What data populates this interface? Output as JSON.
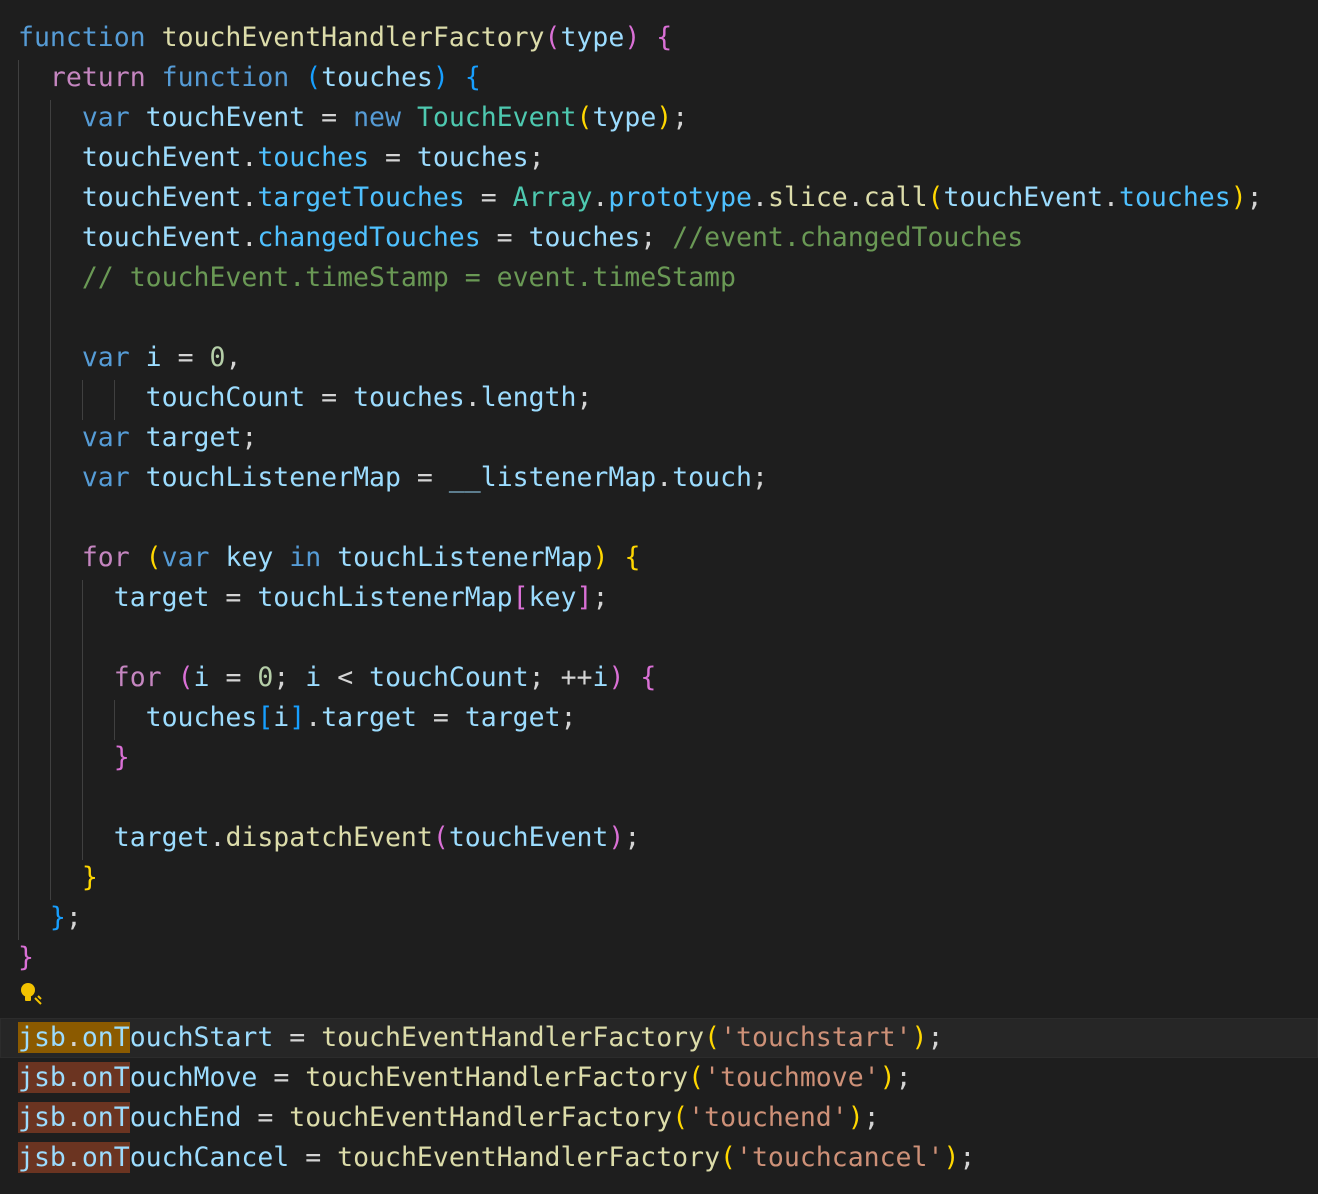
{
  "editor": {
    "language": "javascript",
    "theme_colors": {
      "background": "#1e1e1e",
      "keyword": "#569cd6",
      "control": "#c586c0",
      "function": "#dcdcaa",
      "variable": "#9cdcfe",
      "class": "#4ec9b0",
      "number": "#b5cea8",
      "string": "#ce9178",
      "comment": "#6a9955",
      "bracket_1": "#ffd700",
      "bracket_2": "#da70d6",
      "bracket_3": "#179fff",
      "selection_highlight": "#6b3421"
    },
    "lightbulb_icon": "lightbulb-icon",
    "lines": [
      [
        [
          "kw",
          "function"
        ],
        [
          "op",
          " "
        ],
        [
          "fn",
          "touchEventHandlerFactory"
        ],
        [
          "b2",
          "("
        ],
        [
          "var",
          "type"
        ],
        [
          "b2",
          ")"
        ],
        [
          "op",
          " "
        ],
        [
          "b2",
          "{"
        ]
      ],
      [
        [
          "op",
          "  "
        ],
        [
          "ctl",
          "return"
        ],
        [
          "op",
          " "
        ],
        [
          "kw",
          "function"
        ],
        [
          "op",
          " "
        ],
        [
          "b3",
          "("
        ],
        [
          "var",
          "touches"
        ],
        [
          "b3",
          ")"
        ],
        [
          "op",
          " "
        ],
        [
          "b3",
          "{"
        ]
      ],
      [
        [
          "op",
          "    "
        ],
        [
          "kw",
          "var"
        ],
        [
          "op",
          " "
        ],
        [
          "var",
          "touchEvent"
        ],
        [
          "op",
          " = "
        ],
        [
          "kw",
          "new"
        ],
        [
          "op",
          " "
        ],
        [
          "cls",
          "TouchEvent"
        ],
        [
          "b1",
          "("
        ],
        [
          "var",
          "type"
        ],
        [
          "b1",
          ")"
        ],
        [
          "op",
          ";"
        ]
      ],
      [
        [
          "op",
          "    "
        ],
        [
          "var",
          "touchEvent"
        ],
        [
          "op",
          "."
        ],
        [
          "prop",
          "touches"
        ],
        [
          "op",
          " = "
        ],
        [
          "var",
          "touches"
        ],
        [
          "op",
          ";"
        ]
      ],
      [
        [
          "op",
          "    "
        ],
        [
          "var",
          "touchEvent"
        ],
        [
          "op",
          "."
        ],
        [
          "prop",
          "targetTouches"
        ],
        [
          "op",
          " = "
        ],
        [
          "cls",
          "Array"
        ],
        [
          "op",
          "."
        ],
        [
          "prop",
          "prototype"
        ],
        [
          "op",
          "."
        ],
        [
          "fn",
          "slice"
        ],
        [
          "op",
          "."
        ],
        [
          "fn",
          "call"
        ],
        [
          "b1",
          "("
        ],
        [
          "var",
          "touchEvent"
        ],
        [
          "op",
          "."
        ],
        [
          "prop",
          "touches"
        ],
        [
          "b1",
          ")"
        ],
        [
          "op",
          ";"
        ]
      ],
      [
        [
          "op",
          "    "
        ],
        [
          "var",
          "touchEvent"
        ],
        [
          "op",
          "."
        ],
        [
          "prop",
          "changedTouches"
        ],
        [
          "op",
          " = "
        ],
        [
          "var",
          "touches"
        ],
        [
          "op",
          "; "
        ],
        [
          "cmt",
          "//event.changedTouches"
        ]
      ],
      [
        [
          "op",
          "    "
        ],
        [
          "cmt",
          "// touchEvent.timeStamp = event.timeStamp"
        ]
      ],
      [],
      [
        [
          "op",
          "    "
        ],
        [
          "kw",
          "var"
        ],
        [
          "op",
          " "
        ],
        [
          "var",
          "i"
        ],
        [
          "op",
          " = "
        ],
        [
          "num",
          "0"
        ],
        [
          "op",
          ","
        ]
      ],
      [
        [
          "op",
          "        "
        ],
        [
          "var",
          "touchCount"
        ],
        [
          "op",
          " = "
        ],
        [
          "var",
          "touches"
        ],
        [
          "op",
          "."
        ],
        [
          "var",
          "length"
        ],
        [
          "op",
          ";"
        ]
      ],
      [
        [
          "op",
          "    "
        ],
        [
          "kw",
          "var"
        ],
        [
          "op",
          " "
        ],
        [
          "var",
          "target"
        ],
        [
          "op",
          ";"
        ]
      ],
      [
        [
          "op",
          "    "
        ],
        [
          "kw",
          "var"
        ],
        [
          "op",
          " "
        ],
        [
          "var",
          "touchListenerMap"
        ],
        [
          "op",
          " = "
        ],
        [
          "var",
          "__listenerMap"
        ],
        [
          "op",
          "."
        ],
        [
          "var",
          "touch"
        ],
        [
          "op",
          ";"
        ]
      ],
      [],
      [
        [
          "op",
          "    "
        ],
        [
          "ctl",
          "for"
        ],
        [
          "op",
          " "
        ],
        [
          "b1",
          "("
        ],
        [
          "kw",
          "var"
        ],
        [
          "op",
          " "
        ],
        [
          "var",
          "key"
        ],
        [
          "op",
          " "
        ],
        [
          "kw",
          "in"
        ],
        [
          "op",
          " "
        ],
        [
          "var",
          "touchListenerMap"
        ],
        [
          "b1",
          ")"
        ],
        [
          "op",
          " "
        ],
        [
          "b1",
          "{"
        ]
      ],
      [
        [
          "op",
          "      "
        ],
        [
          "var",
          "target"
        ],
        [
          "op",
          " = "
        ],
        [
          "var",
          "touchListenerMap"
        ],
        [
          "b2",
          "["
        ],
        [
          "var",
          "key"
        ],
        [
          "b2",
          "]"
        ],
        [
          "op",
          ";"
        ]
      ],
      [],
      [
        [
          "op",
          "      "
        ],
        [
          "ctl",
          "for"
        ],
        [
          "op",
          " "
        ],
        [
          "b2",
          "("
        ],
        [
          "var",
          "i"
        ],
        [
          "op",
          " = "
        ],
        [
          "num",
          "0"
        ],
        [
          "op",
          "; "
        ],
        [
          "var",
          "i"
        ],
        [
          "op",
          " < "
        ],
        [
          "var",
          "touchCount"
        ],
        [
          "op",
          "; ++"
        ],
        [
          "var",
          "i"
        ],
        [
          "b2",
          ")"
        ],
        [
          "op",
          " "
        ],
        [
          "b2",
          "{"
        ]
      ],
      [
        [
          "op",
          "        "
        ],
        [
          "var",
          "touches"
        ],
        [
          "b3",
          "["
        ],
        [
          "var",
          "i"
        ],
        [
          "b3",
          "]"
        ],
        [
          "op",
          "."
        ],
        [
          "var",
          "target"
        ],
        [
          "op",
          " = "
        ],
        [
          "var",
          "target"
        ],
        [
          "op",
          ";"
        ]
      ],
      [
        [
          "op",
          "      "
        ],
        [
          "b2",
          "}"
        ]
      ],
      [],
      [
        [
          "op",
          "      "
        ],
        [
          "var",
          "target"
        ],
        [
          "op",
          "."
        ],
        [
          "fn",
          "dispatchEvent"
        ],
        [
          "b2",
          "("
        ],
        [
          "var",
          "touchEvent"
        ],
        [
          "b2",
          ")"
        ],
        [
          "op",
          ";"
        ]
      ],
      [
        [
          "op",
          "    "
        ],
        [
          "b1",
          "}"
        ]
      ],
      [
        [
          "op",
          "  "
        ],
        [
          "b3",
          "}"
        ],
        [
          "op",
          ";"
        ]
      ],
      [
        [
          "b2",
          "}"
        ]
      ],
      [],
      [
        [
          "var",
          "jsb"
        ],
        [
          "op",
          "."
        ],
        [
          "var",
          "onTouchStart"
        ],
        [
          "op",
          " = "
        ],
        [
          "fn",
          "touchEventHandlerFactory"
        ],
        [
          "b1",
          "("
        ],
        [
          "str",
          "'touchstart'"
        ],
        [
          "b1",
          ")"
        ],
        [
          "op",
          ";"
        ]
      ],
      [
        [
          "var",
          "jsb"
        ],
        [
          "op",
          "."
        ],
        [
          "var",
          "onTouchMove"
        ],
        [
          "op",
          " = "
        ],
        [
          "fn",
          "touchEventHandlerFactory"
        ],
        [
          "b1",
          "("
        ],
        [
          "str",
          "'touchmove'"
        ],
        [
          "b1",
          ")"
        ],
        [
          "op",
          ";"
        ]
      ],
      [
        [
          "var",
          "jsb"
        ],
        [
          "op",
          "."
        ],
        [
          "var",
          "onTouchEnd"
        ],
        [
          "op",
          " = "
        ],
        [
          "fn",
          "touchEventHandlerFactory"
        ],
        [
          "b1",
          "("
        ],
        [
          "str",
          "'touchend'"
        ],
        [
          "b1",
          ")"
        ],
        [
          "op",
          ";"
        ]
      ],
      [
        [
          "var",
          "jsb"
        ],
        [
          "op",
          "."
        ],
        [
          "var",
          "onTouchCancel"
        ],
        [
          "op",
          " = "
        ],
        [
          "fn",
          "touchEventHandlerFactory"
        ],
        [
          "b1",
          "("
        ],
        [
          "str",
          "'touchcancel'"
        ],
        [
          "b1",
          ")"
        ],
        [
          "op",
          ";"
        ]
      ]
    ],
    "highlighted_prefix": "jsb.onT"
  }
}
